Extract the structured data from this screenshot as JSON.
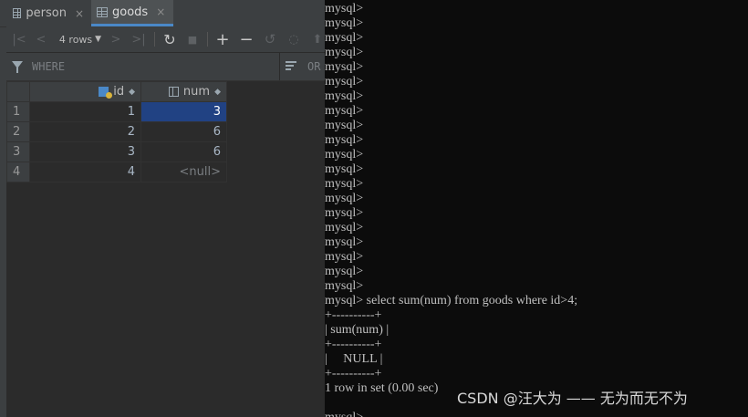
{
  "ide": {
    "tabs": [
      {
        "label": "person",
        "close": "×"
      },
      {
        "label": "goods",
        "close": "×"
      }
    ],
    "toolbar": {
      "rows_label": "4 rows",
      "first": "|<",
      "prev": "<",
      "next": ">",
      "last": ">|",
      "refresh": "↻",
      "stop": "■",
      "add": "+",
      "remove": "−",
      "revert": "↺",
      "submit": "⬆"
    },
    "filter": {
      "where_label": "WHERE",
      "order_label": "OR"
    },
    "table": {
      "columns": [
        "id",
        "num"
      ],
      "rows": [
        {
          "n": "1",
          "id": "1",
          "num": "3"
        },
        {
          "n": "2",
          "id": "2",
          "num": "6"
        },
        {
          "n": "3",
          "id": "3",
          "num": "6"
        },
        {
          "n": "4",
          "id": "4",
          "num": "<null>"
        }
      ]
    }
  },
  "terminal": {
    "lines": [
      "mysql>",
      "mysql>",
      "mysql>",
      "mysql>",
      "mysql>",
      "mysql>",
      "mysql>",
      "mysql>",
      "mysql>",
      "mysql>",
      "mysql>",
      "mysql>",
      "mysql>",
      "mysql>",
      "mysql>",
      "mysql>",
      "mysql>",
      "mysql>",
      "mysql>",
      "mysql>",
      "mysql> select sum(num) from goods where id>4;",
      "+----------+",
      "| sum(num) |",
      "+----------+",
      "|     NULL |",
      "+----------+",
      "1 row in set (0.00 sec)",
      "",
      "mysql>"
    ]
  },
  "watermark": "CSDN @汪大为 —— 无为而无不为"
}
